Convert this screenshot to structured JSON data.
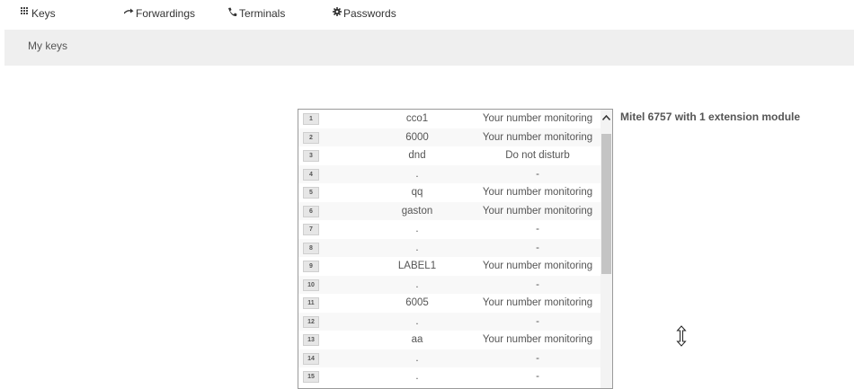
{
  "nav": {
    "keys": {
      "label": "Keys",
      "icon": "grid-icon"
    },
    "forwardings": {
      "label": "Forwardings",
      "icon": "arrow-right-icon"
    },
    "terminals": {
      "label": "Terminals",
      "icon": "phone-icon"
    },
    "passwords": {
      "label": "Passwords",
      "icon": "gear-icon"
    }
  },
  "subbar": {
    "title": "My keys"
  },
  "device": {
    "title": "Mitel 6757 with 1 extension module"
  },
  "keys": [
    {
      "num": "1",
      "label": "cco1",
      "func": "Your number monitoring"
    },
    {
      "num": "2",
      "label": "6000",
      "func": "Your number monitoring"
    },
    {
      "num": "3",
      "label": "dnd",
      "func": "Do not disturb"
    },
    {
      "num": "4",
      "label": ".",
      "func": "-"
    },
    {
      "num": "5",
      "label": "qq",
      "func": "Your number monitoring"
    },
    {
      "num": "6",
      "label": "gaston",
      "func": "Your number monitoring"
    },
    {
      "num": "7",
      "label": ".",
      "func": "-"
    },
    {
      "num": "8",
      "label": ".",
      "func": "-"
    },
    {
      "num": "9",
      "label": "LABEL1",
      "func": "Your number monitoring"
    },
    {
      "num": "10",
      "label": ".",
      "func": "-"
    },
    {
      "num": "11",
      "label": "6005",
      "func": "Your number monitoring"
    },
    {
      "num": "12",
      "label": ".",
      "func": "-"
    },
    {
      "num": "13",
      "label": "aa",
      "func": "Your number monitoring"
    },
    {
      "num": "14",
      "label": ".",
      "func": "-"
    },
    {
      "num": "15",
      "label": ".",
      "func": "-"
    }
  ]
}
